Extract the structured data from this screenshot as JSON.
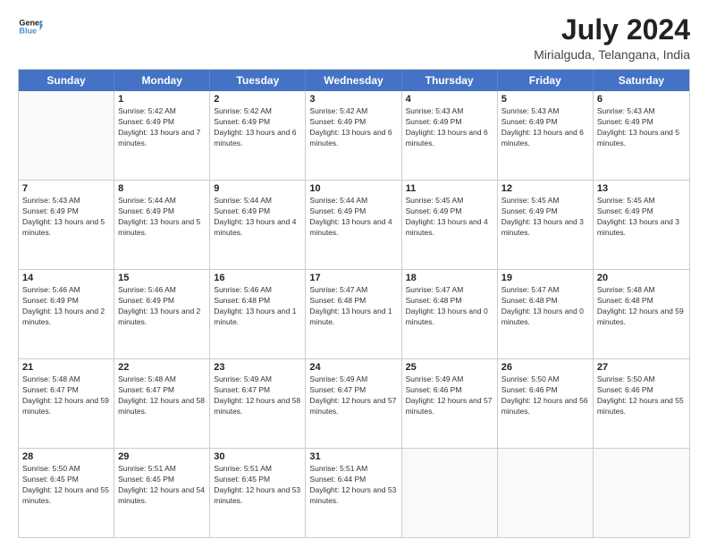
{
  "logo": {
    "line1": "General",
    "line2": "Blue"
  },
  "title": "July 2024",
  "subtitle": "Mirialguda, Telangana, India",
  "header_days": [
    "Sunday",
    "Monday",
    "Tuesday",
    "Wednesday",
    "Thursday",
    "Friday",
    "Saturday"
  ],
  "weeks": [
    [
      {
        "day": "",
        "empty": true
      },
      {
        "day": "1",
        "sunrise": "5:42 AM",
        "sunset": "6:49 PM",
        "daylight": "13 hours and 7 minutes."
      },
      {
        "day": "2",
        "sunrise": "5:42 AM",
        "sunset": "6:49 PM",
        "daylight": "13 hours and 6 minutes."
      },
      {
        "day": "3",
        "sunrise": "5:42 AM",
        "sunset": "6:49 PM",
        "daylight": "13 hours and 6 minutes."
      },
      {
        "day": "4",
        "sunrise": "5:43 AM",
        "sunset": "6:49 PM",
        "daylight": "13 hours and 6 minutes."
      },
      {
        "day": "5",
        "sunrise": "5:43 AM",
        "sunset": "6:49 PM",
        "daylight": "13 hours and 6 minutes."
      },
      {
        "day": "6",
        "sunrise": "5:43 AM",
        "sunset": "6:49 PM",
        "daylight": "13 hours and 5 minutes."
      }
    ],
    [
      {
        "day": "7",
        "sunrise": "5:43 AM",
        "sunset": "6:49 PM",
        "daylight": "13 hours and 5 minutes."
      },
      {
        "day": "8",
        "sunrise": "5:44 AM",
        "sunset": "6:49 PM",
        "daylight": "13 hours and 5 minutes."
      },
      {
        "day": "9",
        "sunrise": "5:44 AM",
        "sunset": "6:49 PM",
        "daylight": "13 hours and 4 minutes."
      },
      {
        "day": "10",
        "sunrise": "5:44 AM",
        "sunset": "6:49 PM",
        "daylight": "13 hours and 4 minutes."
      },
      {
        "day": "11",
        "sunrise": "5:45 AM",
        "sunset": "6:49 PM",
        "daylight": "13 hours and 4 minutes."
      },
      {
        "day": "12",
        "sunrise": "5:45 AM",
        "sunset": "6:49 PM",
        "daylight": "13 hours and 3 minutes."
      },
      {
        "day": "13",
        "sunrise": "5:45 AM",
        "sunset": "6:49 PM",
        "daylight": "13 hours and 3 minutes."
      }
    ],
    [
      {
        "day": "14",
        "sunrise": "5:46 AM",
        "sunset": "6:49 PM",
        "daylight": "13 hours and 2 minutes."
      },
      {
        "day": "15",
        "sunrise": "5:46 AM",
        "sunset": "6:49 PM",
        "daylight": "13 hours and 2 minutes."
      },
      {
        "day": "16",
        "sunrise": "5:46 AM",
        "sunset": "6:48 PM",
        "daylight": "13 hours and 1 minute."
      },
      {
        "day": "17",
        "sunrise": "5:47 AM",
        "sunset": "6:48 PM",
        "daylight": "13 hours and 1 minute."
      },
      {
        "day": "18",
        "sunrise": "5:47 AM",
        "sunset": "6:48 PM",
        "daylight": "13 hours and 0 minutes."
      },
      {
        "day": "19",
        "sunrise": "5:47 AM",
        "sunset": "6:48 PM",
        "daylight": "13 hours and 0 minutes."
      },
      {
        "day": "20",
        "sunrise": "5:48 AM",
        "sunset": "6:48 PM",
        "daylight": "12 hours and 59 minutes."
      }
    ],
    [
      {
        "day": "21",
        "sunrise": "5:48 AM",
        "sunset": "6:47 PM",
        "daylight": "12 hours and 59 minutes."
      },
      {
        "day": "22",
        "sunrise": "5:48 AM",
        "sunset": "6:47 PM",
        "daylight": "12 hours and 58 minutes."
      },
      {
        "day": "23",
        "sunrise": "5:49 AM",
        "sunset": "6:47 PM",
        "daylight": "12 hours and 58 minutes."
      },
      {
        "day": "24",
        "sunrise": "5:49 AM",
        "sunset": "6:47 PM",
        "daylight": "12 hours and 57 minutes."
      },
      {
        "day": "25",
        "sunrise": "5:49 AM",
        "sunset": "6:46 PM",
        "daylight": "12 hours and 57 minutes."
      },
      {
        "day": "26",
        "sunrise": "5:50 AM",
        "sunset": "6:46 PM",
        "daylight": "12 hours and 56 minutes."
      },
      {
        "day": "27",
        "sunrise": "5:50 AM",
        "sunset": "6:46 PM",
        "daylight": "12 hours and 55 minutes."
      }
    ],
    [
      {
        "day": "28",
        "sunrise": "5:50 AM",
        "sunset": "6:45 PM",
        "daylight": "12 hours and 55 minutes."
      },
      {
        "day": "29",
        "sunrise": "5:51 AM",
        "sunset": "6:45 PM",
        "daylight": "12 hours and 54 minutes."
      },
      {
        "day": "30",
        "sunrise": "5:51 AM",
        "sunset": "6:45 PM",
        "daylight": "12 hours and 53 minutes."
      },
      {
        "day": "31",
        "sunrise": "5:51 AM",
        "sunset": "6:44 PM",
        "daylight": "12 hours and 53 minutes."
      },
      {
        "day": "",
        "empty": true
      },
      {
        "day": "",
        "empty": true
      },
      {
        "day": "",
        "empty": true
      }
    ]
  ]
}
